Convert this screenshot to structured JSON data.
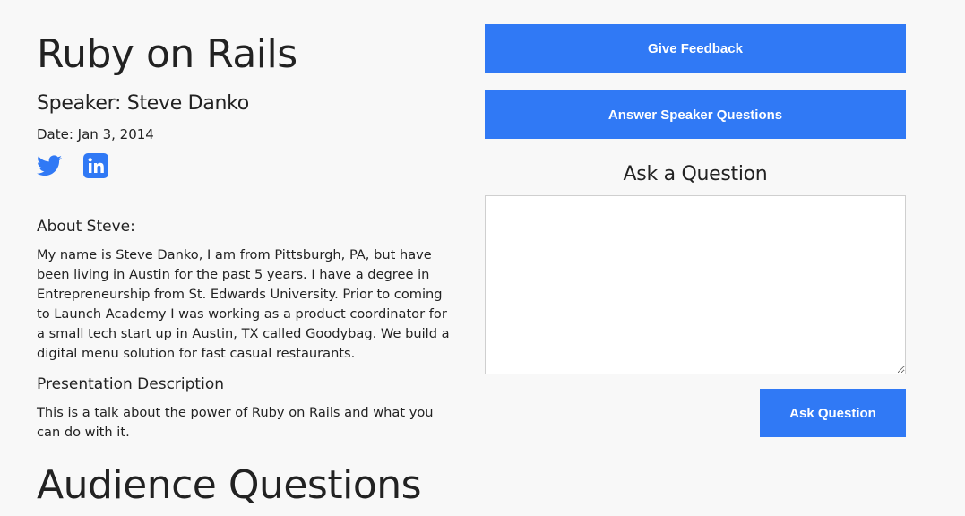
{
  "talk": {
    "title": "Ruby on Rails",
    "speaker": "Speaker: Steve Danko",
    "date": "Date: Jan 3, 2014"
  },
  "social": {
    "twitter_icon": "twitter-icon",
    "linkedin_icon": "linkedin-icon",
    "accent_color": "#3079f5"
  },
  "about": {
    "heading": "About Steve:",
    "text": "My name is Steve Danko, I am from Pittsburgh, PA, but have been living in Austin for the past 5 years. I have a degree in Entrepreneurship from St. Edwards University. Prior to coming to Launch Academy I was working as a product coordinator for a small tech start up in Austin, TX called Goodybag. We build a digital menu solution for fast casual restaurants."
  },
  "presentation": {
    "heading": "Presentation Description",
    "text": "This is a talk about the power of Ruby on Rails and what you can do with it."
  },
  "audience": {
    "heading": "Audience Questions"
  },
  "actions": {
    "feedback_label": "Give Feedback",
    "answer_label": "Answer Speaker Questions"
  },
  "ask": {
    "heading": "Ask a Question",
    "textarea_value": "",
    "button_label": "Ask Question"
  }
}
